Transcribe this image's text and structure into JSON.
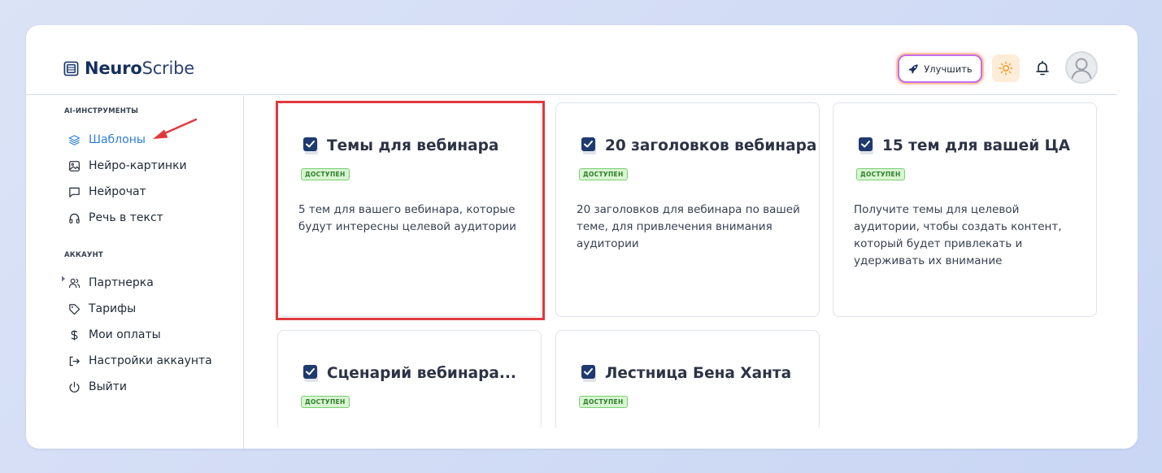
{
  "app": {
    "brand_bold": "Neuro",
    "brand_rest": "Scribe"
  },
  "header": {
    "upgrade_label": "Улучшить",
    "icons": [
      "rocket-icon",
      "sun-icon",
      "bell-icon",
      "user-avatar"
    ]
  },
  "sidebar": {
    "sections": [
      {
        "label": "AI-ИНСТРУМЕНТЫ",
        "items": [
          {
            "label": "Шаблоны",
            "icon": "layers-icon",
            "active": true
          },
          {
            "label": "Нейро-картинки",
            "icon": "image-icon"
          },
          {
            "label": "Нейрочат",
            "icon": "chat-icon"
          },
          {
            "label": "Речь в текст",
            "icon": "headphones-icon"
          }
        ]
      },
      {
        "label": "АККАУНТ",
        "items": [
          {
            "label": "Партнерка",
            "icon": "users-icon",
            "expandable": true
          },
          {
            "label": "Тарифы",
            "icon": "tag-icon"
          },
          {
            "label": "Мои оплаты",
            "icon": "dollar-icon"
          },
          {
            "label": "Настройки аккаунта",
            "icon": "logout-arrow-icon"
          },
          {
            "label": "Выйти",
            "icon": "power-icon"
          }
        ]
      }
    ]
  },
  "cards": [
    {
      "title": "Темы для вебинара",
      "badge": "ДОСТУПЕН",
      "description": "5 тем для вашего вебинара, которые будут интересны целевой аудитории",
      "highlighted": true
    },
    {
      "title": "20 заголовков вебинара",
      "badge": "ДОСТУПЕН",
      "description": "20 заголовков для вебинара по вашей теме, для привлечения внимания аудитории"
    },
    {
      "title": "15 тем для вашей ЦА",
      "badge": "ДОСТУПЕН",
      "description": "Получите темы для целевой аудитории, чтобы создать контент, который будет привлекать и удерживать их внимание"
    },
    {
      "title": "Сценарий вебинара...",
      "badge": "ДОСТУПЕН",
      "description": ""
    },
    {
      "title": "Лестница Бена Ханта",
      "badge": "ДОСТУПЕН",
      "description": ""
    }
  ],
  "colors": {
    "accent": "#2f7fd4",
    "highlight": "#e0393e",
    "badge_bg": "#d8f5d2",
    "badge_text": "#2f7d2a"
  }
}
